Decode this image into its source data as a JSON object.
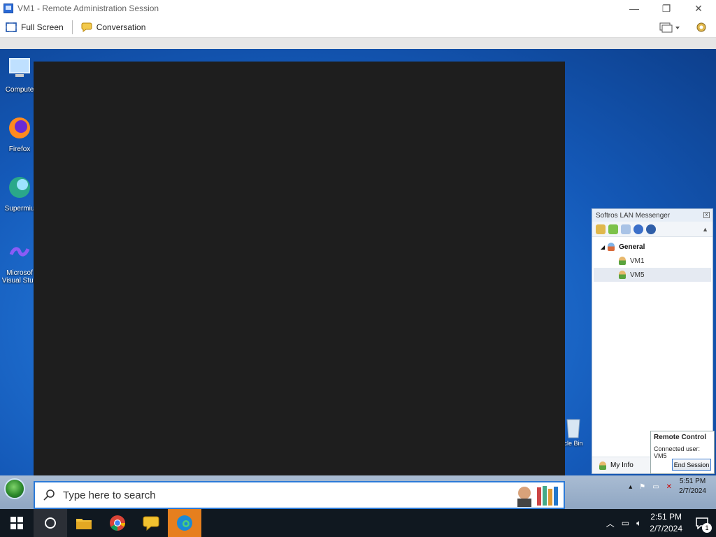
{
  "window": {
    "title": "VM1 - Remote Administration Session",
    "controls": {
      "minimize": "—",
      "restore": "❐",
      "close": "✕"
    }
  },
  "toolbar": {
    "full_screen": "Full Screen",
    "conversation": "Conversation"
  },
  "desktop": {
    "icons": [
      "Compute",
      "Firefox",
      "Supermiu",
      "Microsof Visual Stud"
    ],
    "recycle_label": "cle Bin"
  },
  "search": {
    "placeholder": "Type here to search"
  },
  "softros": {
    "title": "Softros LAN Messenger",
    "group": "General",
    "users": [
      "VM1",
      "VM5"
    ],
    "selected_user": "VM5",
    "my_info": "My Info"
  },
  "remote_control": {
    "title": "Remote Control",
    "connected_label": "Connected user:",
    "connected_user": "VM5",
    "end_button": "End Session"
  },
  "inner_clock": {
    "time": "5:51 PM",
    "date": "2/7/2024"
  },
  "host_clock": {
    "time": "2:51 PM",
    "date": "2/7/2024"
  },
  "notifications": {
    "count": "1"
  },
  "colors": {
    "accent": "#2b7ad8",
    "taskbar": "#101820",
    "remote_bg": "#1f6fd0"
  }
}
